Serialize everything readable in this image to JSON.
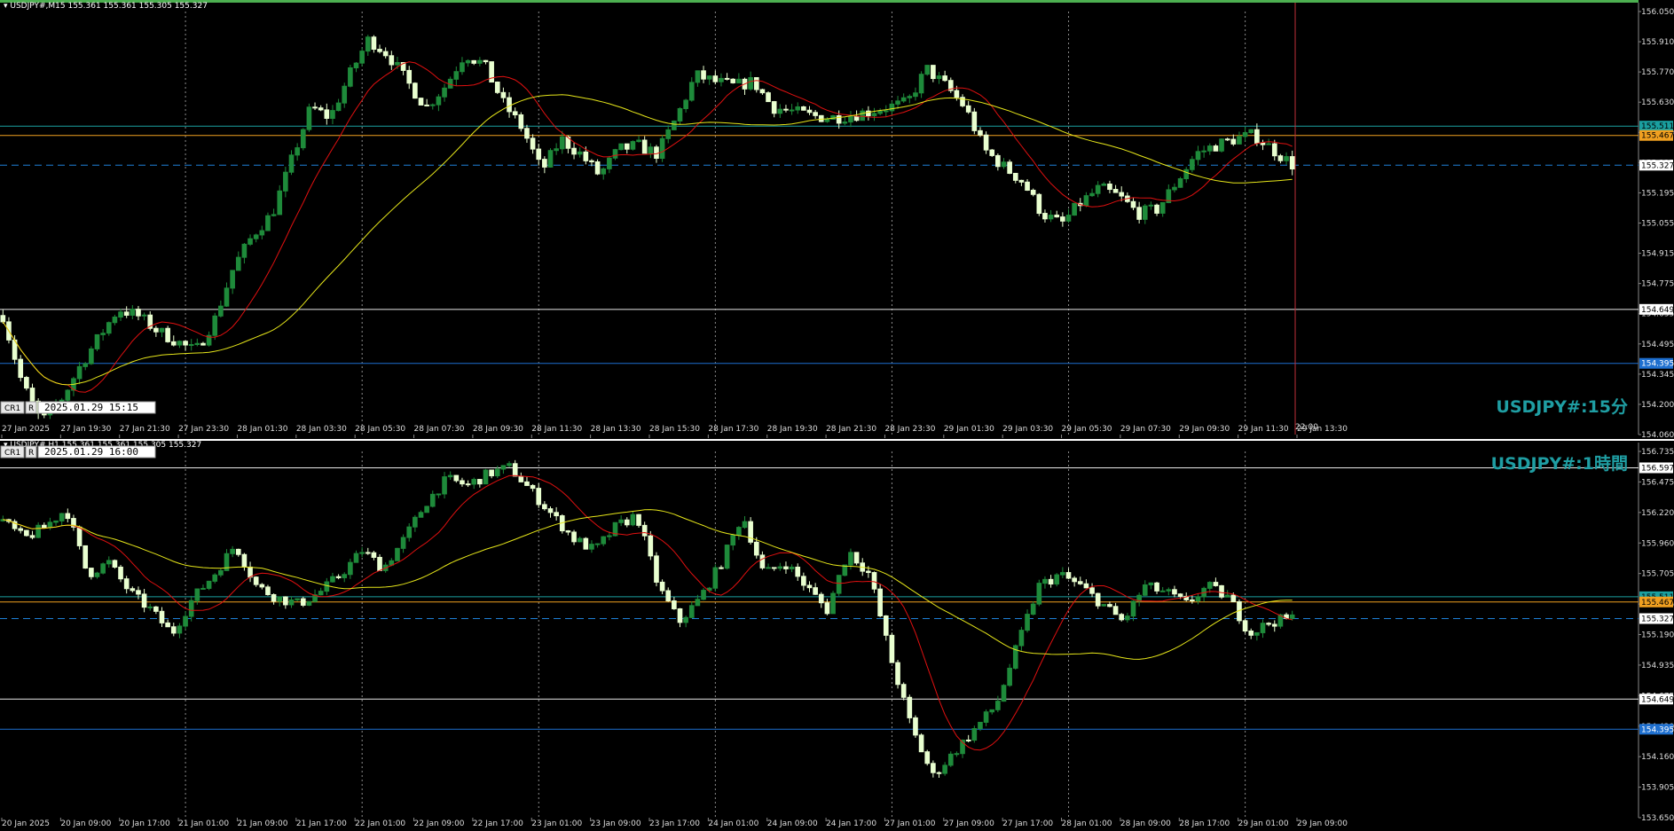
{
  "colors": {
    "background": "#000000",
    "grid": "#c8c8c8",
    "candle_up": "#1e8a3a",
    "candle_down": "#e9ffd0",
    "ma_fast": "#e01010",
    "ma_slow": "#e6e61a",
    "bid_line": "#1e7fd6",
    "top_bar": "#4caf50",
    "resistance_line": "#e8e8e8",
    "support_line": "#1e6fcf",
    "orange_line": "#f0a020",
    "teal_line": "#1aa0a0",
    "watermark": "#1f9ea3"
  },
  "chart_data": [
    {
      "type": "candlestick",
      "header": "USDJPY#,M15  155.361 155.361 155.305 155.327",
      "watermark": "USDJPY#:15分",
      "toolbar": {
        "cr_label": "CR1",
        "r_label": "R",
        "datetime": "2025.01.29 15:15"
      },
      "crosshair_time_label": "22:00",
      "ylim": [
        154.06,
        156.05
      ],
      "y_ticks": [
        "156.050",
        "155.910",
        "155.770",
        "155.630",
        "155.490",
        "155.335",
        "155.195",
        "155.055",
        "154.915",
        "154.775",
        "154.635",
        "154.495",
        "154.345",
        "154.200",
        "154.060"
      ],
      "x_labels": [
        "27 Jan 2025",
        "27 Jan 19:30",
        "27 Jan 21:30",
        "27 Jan 23:30",
        "28 Jan 01:30",
        "28 Jan 03:30",
        "28 Jan 05:30",
        "28 Jan 07:30",
        "28 Jan 09:30",
        "28 Jan 11:30",
        "28 Jan 13:30",
        "28 Jan 15:30",
        "28 Jan 17:30",
        "28 Jan 19:30",
        "28 Jan 21:30",
        "28 Jan 23:30",
        "29 Jan 01:30",
        "29 Jan 03:30",
        "29 Jan 05:30",
        "29 Jan 07:30",
        "29 Jan 09:30",
        "29 Jan 11:30",
        "29 Jan 13:30"
      ],
      "price_tags": [
        {
          "value": 155.511,
          "label": "155.511",
          "role": "teal"
        },
        {
          "value": 155.467,
          "label": "155.467",
          "role": "orange"
        },
        {
          "value": 155.327,
          "label": "155.327",
          "role": "bid"
        },
        {
          "value": 154.649,
          "label": "154.649",
          "role": "resistance"
        },
        {
          "value": 154.395,
          "label": "154.395",
          "role": "support"
        }
      ],
      "close_path": [
        [
          0,
          154.62
        ],
        [
          1,
          154.3
        ],
        [
          2,
          154.12
        ],
        [
          3,
          154.22
        ],
        [
          4,
          154.38
        ],
        [
          5,
          154.52
        ],
        [
          6,
          154.65
        ],
        [
          7,
          154.62
        ],
        [
          8,
          154.55
        ],
        [
          9,
          154.5
        ],
        [
          10,
          154.45
        ],
        [
          11,
          154.6
        ],
        [
          12,
          154.85
        ],
        [
          13,
          155.0
        ],
        [
          14,
          155.1
        ],
        [
          15,
          155.35
        ],
        [
          16,
          155.6
        ],
        [
          17,
          155.55
        ],
        [
          18,
          155.75
        ],
        [
          19,
          155.92
        ],
        [
          20,
          155.85
        ],
        [
          21,
          155.72
        ],
        [
          22,
          155.6
        ],
        [
          23,
          155.7
        ],
        [
          24,
          155.85
        ],
        [
          25,
          155.8
        ],
        [
          26,
          155.62
        ],
        [
          27,
          155.5
        ],
        [
          28,
          155.3
        ],
        [
          29,
          155.45
        ],
        [
          30,
          155.38
        ],
        [
          31,
          155.28
        ],
        [
          32,
          155.4
        ],
        [
          33,
          155.42
        ],
        [
          34,
          155.38
        ],
        [
          35,
          155.55
        ],
        [
          36,
          155.75
        ],
        [
          37,
          155.72
        ],
        [
          38,
          155.7
        ],
        [
          39,
          155.72
        ],
        [
          40,
          155.6
        ],
        [
          41,
          155.58
        ],
        [
          42,
          155.56
        ],
        [
          43,
          155.55
        ],
        [
          44,
          155.56
        ],
        [
          45,
          155.58
        ],
        [
          46,
          155.6
        ],
        [
          47,
          155.62
        ],
        [
          48,
          155.78
        ],
        [
          49,
          155.7
        ],
        [
          50,
          155.6
        ],
        [
          51,
          155.4
        ],
        [
          52,
          155.32
        ],
        [
          53,
          155.25
        ],
        [
          54,
          155.1
        ],
        [
          55,
          155.05
        ],
        [
          56,
          155.15
        ],
        [
          57,
          155.22
        ],
        [
          58,
          155.18
        ],
        [
          59,
          155.1
        ],
        [
          60,
          155.12
        ],
        [
          61,
          155.25
        ],
        [
          62,
          155.38
        ],
        [
          63,
          155.42
        ],
        [
          64,
          155.45
        ],
        [
          65,
          155.47
        ],
        [
          66,
          155.4
        ],
        [
          67,
          155.33
        ]
      ]
    },
    {
      "type": "candlestick",
      "header": "USDJPY#,H1  155.361 155.361 155.305 155.327",
      "watermark": "USDJPY#:1時間",
      "toolbar": {
        "cr_label": "CR1",
        "r_label": "R",
        "datetime": "2025.01.29 16:00"
      },
      "ylim": [
        153.65,
        156.735
      ],
      "y_ticks": [
        "156.735",
        "156.475",
        "156.220",
        "155.960",
        "155.705",
        "155.445",
        "155.190",
        "154.935",
        "154.675",
        "154.420",
        "154.160",
        "153.905",
        "153.650"
      ],
      "x_labels": [
        "20 Jan 2025",
        "20 Jan 09:00",
        "20 Jan 17:00",
        "21 Jan 01:00",
        "21 Jan 09:00",
        "21 Jan 17:00",
        "22 Jan 01:00",
        "22 Jan 09:00",
        "22 Jan 17:00",
        "23 Jan 01:00",
        "23 Jan 09:00",
        "23 Jan 17:00",
        "24 Jan 01:00",
        "24 Jan 09:00",
        "24 Jan 17:00",
        "27 Jan 01:00",
        "27 Jan 09:00",
        "27 Jan 17:00",
        "28 Jan 01:00",
        "28 Jan 09:00",
        "28 Jan 17:00",
        "29 Jan 01:00",
        "29 Jan 09:00"
      ],
      "price_tags": [
        {
          "value": 156.597,
          "label": "156.597",
          "role": "resistance"
        },
        {
          "value": 155.511,
          "label": "155.511",
          "role": "teal"
        },
        {
          "value": 155.467,
          "label": "155.467",
          "role": "orange"
        },
        {
          "value": 155.327,
          "label": "155.327",
          "role": "bid"
        },
        {
          "value": 154.649,
          "label": "154.649",
          "role": "resistance"
        },
        {
          "value": 154.395,
          "label": "154.395",
          "role": "support"
        }
      ],
      "close_path": [
        [
          0,
          156.15
        ],
        [
          1,
          156.0
        ],
        [
          2,
          156.1
        ],
        [
          3,
          156.25
        ],
        [
          4,
          155.7
        ],
        [
          5,
          155.8
        ],
        [
          6,
          155.55
        ],
        [
          7,
          155.4
        ],
        [
          8,
          155.2
        ],
        [
          9,
          155.5
        ],
        [
          10,
          155.7
        ],
        [
          11,
          155.95
        ],
        [
          12,
          155.6
        ],
        [
          13,
          155.5
        ],
        [
          14,
          155.45
        ],
        [
          15,
          155.55
        ],
        [
          16,
          155.7
        ],
        [
          17,
          155.9
        ],
        [
          18,
          155.75
        ],
        [
          19,
          156.0
        ],
        [
          20,
          156.3
        ],
        [
          21,
          156.5
        ],
        [
          22,
          156.45
        ],
        [
          23,
          156.55
        ],
        [
          24,
          156.6
        ],
        [
          25,
          156.4
        ],
        [
          26,
          156.2
        ],
        [
          27,
          156.0
        ],
        [
          28,
          155.9
        ],
        [
          29,
          156.1
        ],
        [
          30,
          156.2
        ],
        [
          31,
          155.6
        ],
        [
          32,
          155.3
        ],
        [
          33,
          155.5
        ],
        [
          34,
          155.8
        ],
        [
          35,
          156.2
        ],
        [
          36,
          155.7
        ],
        [
          37,
          155.8
        ],
        [
          38,
          155.6
        ],
        [
          39,
          155.4
        ],
        [
          40,
          155.9
        ],
        [
          41,
          155.7
        ],
        [
          42,
          155.0
        ],
        [
          43,
          154.4
        ],
        [
          44,
          154.0
        ],
        [
          45,
          154.2
        ],
        [
          46,
          154.4
        ],
        [
          47,
          154.6
        ],
        [
          48,
          155.1
        ],
        [
          49,
          155.6
        ],
        [
          50,
          155.7
        ],
        [
          51,
          155.6
        ],
        [
          52,
          155.45
        ],
        [
          53,
          155.3
        ],
        [
          54,
          155.6
        ],
        [
          55,
          155.55
        ],
        [
          56,
          155.45
        ],
        [
          57,
          155.6
        ],
        [
          58,
          155.5
        ],
        [
          59,
          155.2
        ],
        [
          60,
          155.3
        ],
        [
          61,
          155.33
        ]
      ]
    }
  ]
}
